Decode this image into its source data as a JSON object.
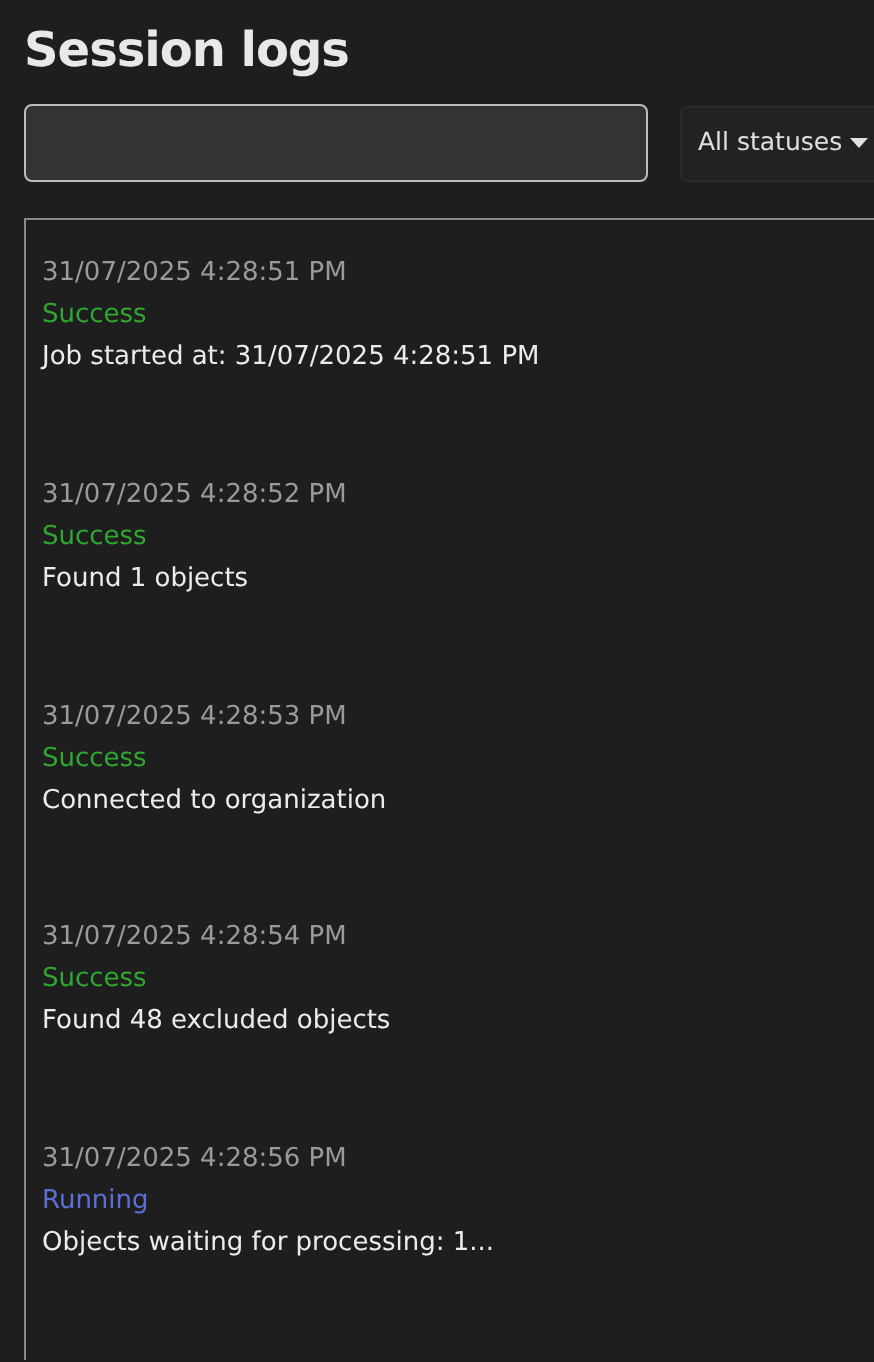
{
  "title": "Session logs",
  "status_filter": {
    "value": "All statuses"
  },
  "logs": [
    {
      "timestamp": "31/07/2025 4:28:51 PM",
      "status": "Success",
      "kind": "success",
      "message": "Job started at: 31/07/2025 4:28:51 PM"
    },
    {
      "timestamp": "31/07/2025 4:28:52 PM",
      "status": "Success",
      "kind": "success",
      "message": "Found 1 objects"
    },
    {
      "timestamp": "31/07/2025 4:28:53 PM",
      "status": "Success",
      "kind": "success",
      "message": "Connected to organization"
    },
    {
      "timestamp": "31/07/2025 4:28:54 PM",
      "status": "Success",
      "kind": "success",
      "message": "Found 48 excluded objects"
    },
    {
      "timestamp": "31/07/2025 4:28:56 PM",
      "status": "Running",
      "kind": "running",
      "message": "Objects waiting for processing: 1..."
    }
  ]
}
